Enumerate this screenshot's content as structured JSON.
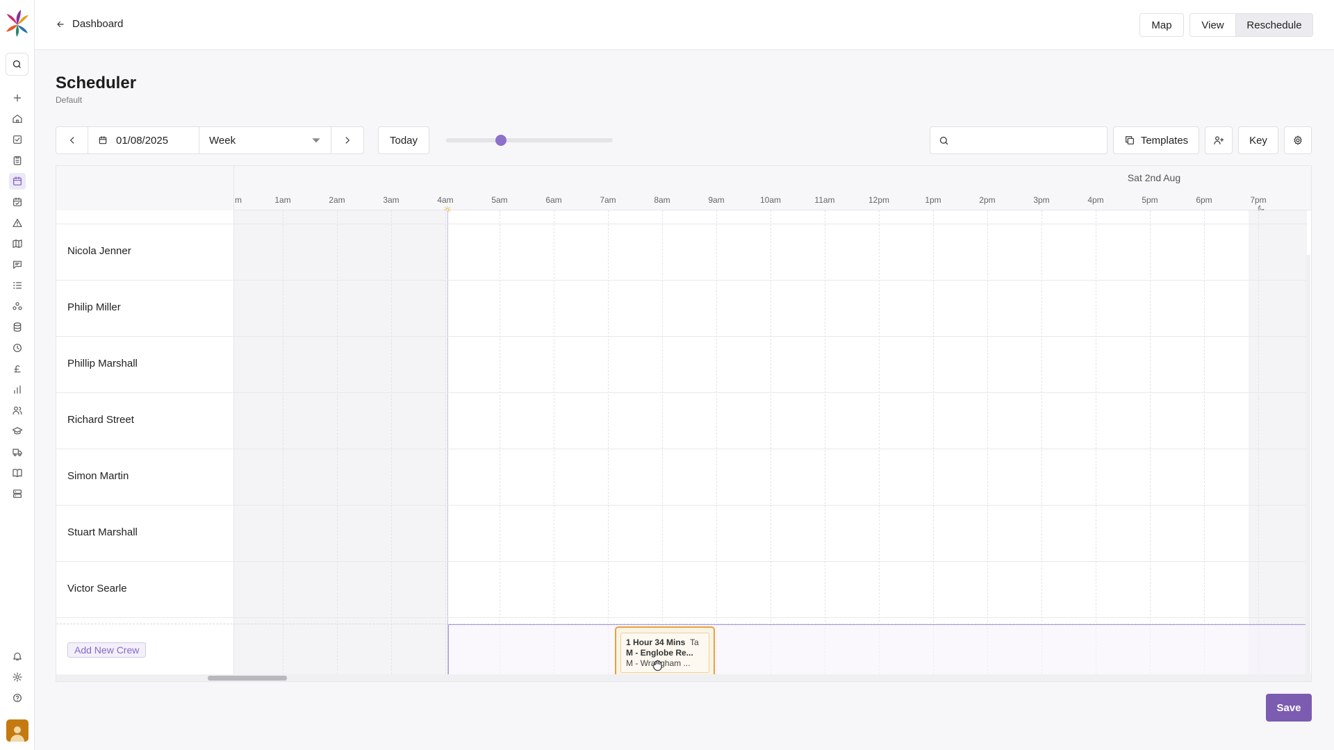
{
  "topbar": {
    "back_label": "Dashboard",
    "map_label": "Map",
    "view_label": "View",
    "reschedule_label": "Reschedule"
  },
  "page": {
    "title": "Scheduler",
    "subtitle": "Default"
  },
  "toolbar": {
    "date_value": "01/08/2025",
    "range_value": "Week",
    "today_label": "Today",
    "zoom_slider_value": 0.33,
    "search_value": "",
    "search_placeholder": "",
    "templates_label": "Templates",
    "key_label": "Key"
  },
  "scheduler": {
    "day_label": "Sat 2nd Aug",
    "hours": [
      "m",
      "1am",
      "2am",
      "3am",
      "4am",
      "5am",
      "6am",
      "7am",
      "8am",
      "9am",
      "10am",
      "11am",
      "12pm",
      "1pm",
      "2pm",
      "3pm",
      "4pm",
      "5pm",
      "6pm",
      "7pm"
    ],
    "crews": [
      "Nicola Jenner",
      "Philip Miller",
      "Phillip Marshall",
      "Richard Street",
      "Simon Martin",
      "Stuart Marshall",
      "Victor Searle"
    ],
    "add_crew_label": "Add New Crew",
    "job_card": {
      "duration": "1 Hour 34 Mins",
      "tag": "Ta",
      "line1": "M - Englobe Re...",
      "line2": "M - Wrangham ..."
    }
  },
  "footer": {
    "save_label": "Save"
  },
  "colors": {
    "accent": "#7b5cb0",
    "job_border": "#e6a23c",
    "avatar": "#c47a10"
  },
  "icons": {
    "sidebar": [
      "plus-icon",
      "home-icon",
      "checkbox-icon",
      "clipboard-icon",
      "calendar-icon",
      "calendar-check-icon",
      "warning-icon",
      "map-icon",
      "message-icon",
      "list-icon",
      "network-icon",
      "database-icon",
      "clock-icon",
      "pound-icon",
      "chart-icon",
      "users-icon",
      "graduation-icon",
      "truck-icon",
      "book-icon",
      "server-icon"
    ],
    "sidebar_bottom": [
      "bell-icon",
      "gear-icon",
      "help-icon"
    ]
  }
}
